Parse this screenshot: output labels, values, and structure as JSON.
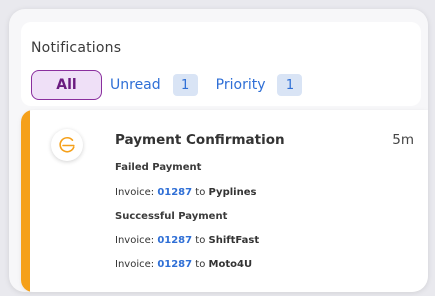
{
  "header": {
    "title": "Notifications",
    "tabs": {
      "all": "All",
      "unread": "Unread",
      "unread_count": "1",
      "priority": "Priority",
      "priority_count": "1"
    }
  },
  "notification": {
    "title": "Payment Confirmation",
    "time": "5m",
    "failed_heading": "Failed Payment",
    "successful_heading": "Successful Payment",
    "invoice_prefix": "Invoice:",
    "to_word": "to",
    "items": [
      {
        "invoice": "01287",
        "vendor": "Pyplines"
      },
      {
        "invoice": "01287",
        "vendor": "ShiftFast"
      },
      {
        "invoice": "01287",
        "vendor": "Moto4U"
      }
    ]
  },
  "colors": {
    "accent": "#f5a01a",
    "link": "#2f6fd6",
    "selected_tab": "#8a2f9e"
  },
  "icons": {
    "logo": "g-logo-icon"
  }
}
